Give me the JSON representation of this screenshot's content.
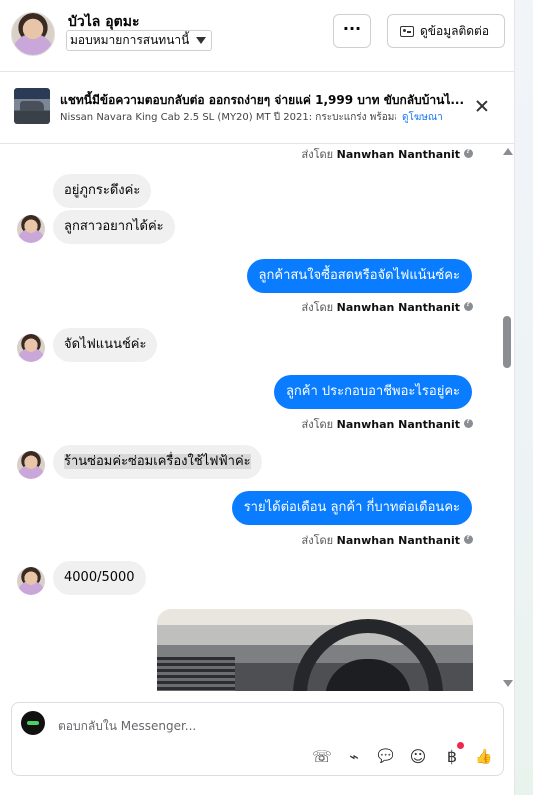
{
  "header": {
    "contact_name": "บัวไล อุตมะ",
    "assign_label": "มอบหมายการสนทนานี้",
    "more_label": "···",
    "info_button": "ดูข้อมูลติดต่อ"
  },
  "ad": {
    "title": "แชทนี้มีข้อความตอบกลับต่อ ออกรถง่ายๆ จ่ายแค่ 1,999 บาท ขับกลับบ้านไ...",
    "subtitle": "Nissan Navara King Cab 2.5 SL (MY20) MT ปี 2021: กระบะแกร่ง พร้อมลุ...",
    "link": "ดูโฆษณา"
  },
  "sent_by_prefix": "ส่งโดย",
  "sender_name": "Nanwhan Nanthanit",
  "messages": {
    "m1": "อยู่ภูกระดึงค่ะ",
    "m2": "ลูกสาวอยากได้ค่ะ",
    "m3": "ลูกค้าสนใจซื้อสดหรือจัดไฟแน้นซ์คะ",
    "m4": "จัดไฟแนนช์ค่ะ",
    "m5": "ลูกค้า ประกอบอาชีพอะไรอยู่คะ",
    "m6": "ร้านซ่อมค่ะซ่อมเครื่องใช้ไฟฟ้าค่ะ",
    "m7": "รายได้ต่อเดือน ลูกค้า กี่บาทต่อเดือนคะ",
    "m8": "4000/5000"
  },
  "composer": {
    "placeholder": "ตอบกลับใน Messenger..."
  },
  "icons": {
    "call": "☏",
    "attach": "⌁",
    "saved_reply": "💬",
    "emoji": "☺",
    "payment": "฿",
    "like": "👍"
  }
}
